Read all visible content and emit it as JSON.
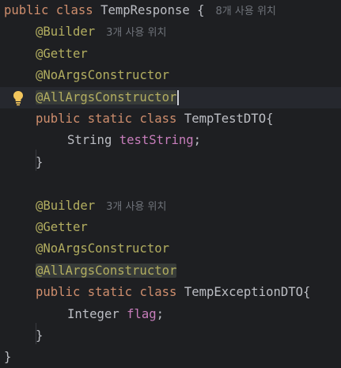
{
  "code": {
    "lines": [
      {
        "parts": [
          "public",
          "class",
          "TempResponse",
          "{"
        ],
        "hint": "8개 사용 위치"
      },
      {
        "parts": [
          "@Builder"
        ],
        "hint": "3개 사용 위치"
      },
      {
        "parts": [
          "@Getter"
        ]
      },
      {
        "parts": [
          "@NoArgsConstructor"
        ]
      },
      {
        "parts": [
          "@AllArgsConstructor"
        ]
      },
      {
        "parts": [
          "public",
          "static",
          "class",
          "TempTestDTO{"
        ]
      },
      {
        "parts": [
          "String",
          "testString",
          ";"
        ]
      },
      {
        "parts": [
          "}"
        ]
      },
      {
        "parts": []
      },
      {
        "parts": [
          "@Builder"
        ],
        "hint": "3개 사용 위치"
      },
      {
        "parts": [
          "@Getter"
        ]
      },
      {
        "parts": [
          "@NoArgsConstructor"
        ]
      },
      {
        "parts": [
          "@AllArgsConstructor"
        ]
      },
      {
        "parts": [
          "public",
          "static",
          "class",
          "TempExceptionDTO{"
        ]
      },
      {
        "parts": [
          "Integer",
          "flag",
          ";"
        ]
      },
      {
        "parts": [
          "}"
        ]
      },
      {
        "parts": [
          "}"
        ]
      }
    ]
  },
  "theme": {
    "background": "#1e1f22",
    "keyword": "#cf8e6d",
    "annotation": "#b3ae60",
    "field": "#c77dbb",
    "text": "#bcbec4",
    "hint": "#6f737a",
    "bulb": "#f2c55c"
  },
  "icons": {
    "gutter": "intention-bulb-icon"
  }
}
